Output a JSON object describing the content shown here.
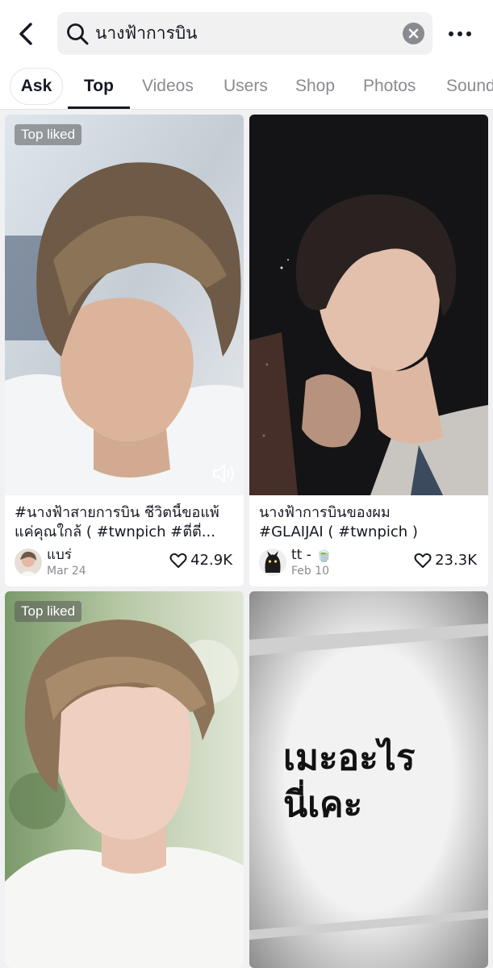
{
  "search": {
    "query": "นางฟ้าการบิน"
  },
  "tabs": [
    "Ask",
    "Top",
    "Videos",
    "Users",
    "Shop",
    "Photos",
    "Sound"
  ],
  "active_tab": "Top",
  "colors": {
    "text": "#161823",
    "muted": "#8a8b91",
    "search_bg": "#f1f1f2",
    "page_bg": "#f1f1f3"
  },
  "icons": [
    "back-arrow-icon",
    "search-icon",
    "clear-icon",
    "more-icon",
    "sound-icon",
    "heart-icon"
  ],
  "posts": [
    {
      "badge": "Top liked",
      "caption_line1": "#นางฟ้าสายการบิน ชีวิตนี้ขอแพ้",
      "caption_line2": "แค่คุณใกล้ ( #twnpich #ตี๋ตี๋...",
      "author": "แบร่",
      "date": "Mar 24",
      "likes": "42.9K"
    },
    {
      "badge": "",
      "caption_line1": "นางฟ้าการบินของผม",
      "caption_line2": "#GLAIJAI ( #twnpich )",
      "author": "tt - 🍵",
      "date": "Feb 10",
      "likes": "23.3K"
    },
    {
      "badge": "Top liked",
      "caption_line1": "",
      "caption_line2": "",
      "author": "",
      "date": "",
      "likes": ""
    },
    {
      "badge": "",
      "overlay_line1": "เมะอะไร",
      "overlay_line2": "นี่เคะ"
    }
  ]
}
